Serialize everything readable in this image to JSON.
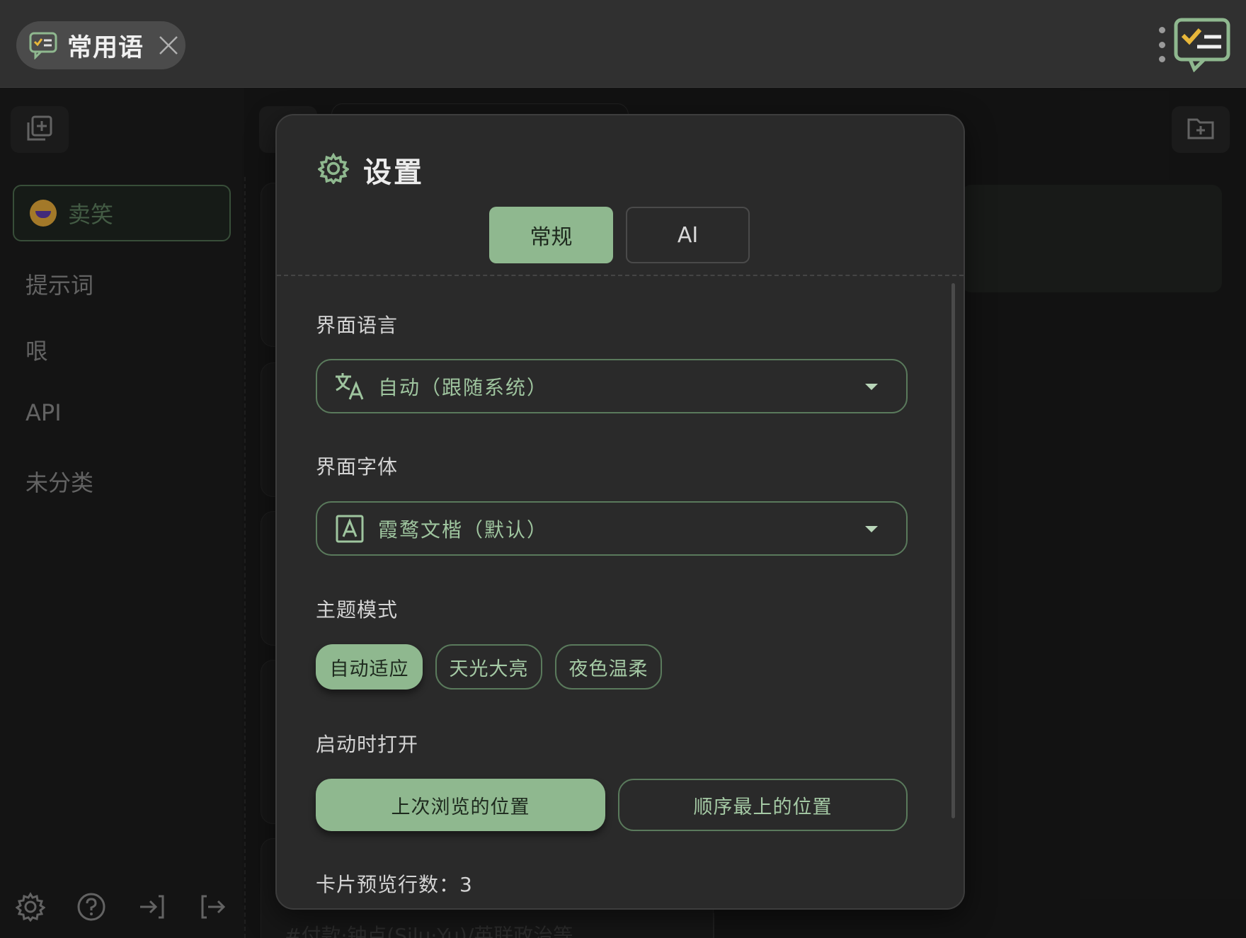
{
  "app": {
    "tab_title": "常用语"
  },
  "sidebar": {
    "categories": [
      {
        "label": "卖笑",
        "active": true
      },
      {
        "label": "提示词"
      },
      {
        "label": "哏"
      },
      {
        "label": "API"
      },
      {
        "label": "未分类"
      }
    ]
  },
  "settings": {
    "title": "设置",
    "tabs": [
      {
        "label": "常规",
        "active": true
      },
      {
        "label": "AI"
      }
    ],
    "language": {
      "label": "界面语言",
      "value": "自动（跟随系统）"
    },
    "font": {
      "label": "界面字体",
      "value": "霞鹜文楷（默认）"
    },
    "theme": {
      "label": "主题模式",
      "options": [
        "自动适应",
        "天光大亮",
        "夜色温柔"
      ],
      "selected": "自动适应"
    },
    "startup": {
      "label": "启动时打开",
      "options": [
        "上次浏览的位置",
        "顺序最上的位置"
      ],
      "selected": "上次浏览的位置"
    },
    "preview_lines": {
      "label": "卡片预览行数：",
      "value": "3"
    }
  },
  "background": {
    "peek_text": "#付款·钟点(Silu·Yu)/英联政治等"
  },
  "colors": {
    "accent": "#8fb88f",
    "accent_text": "#9fc59f",
    "border_accent": "#5a7a5c",
    "modal_bg": "#2a2a2a",
    "topbar_bg": "#303030",
    "logo_check": "#e8b73a"
  }
}
